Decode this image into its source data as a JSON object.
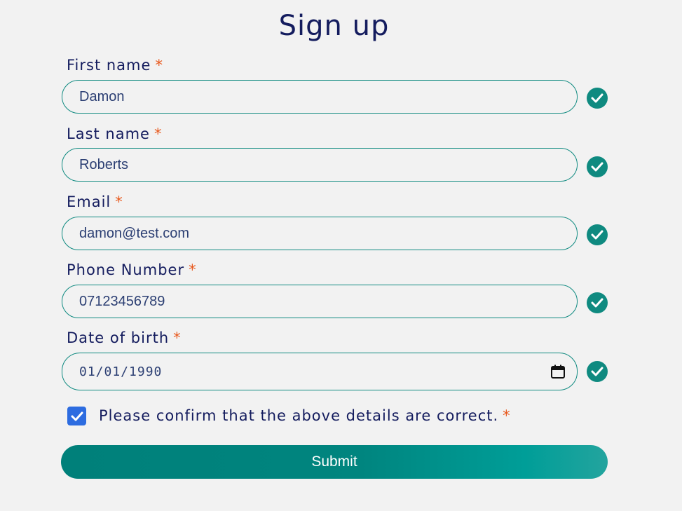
{
  "form": {
    "title": "Sign up",
    "required_marker": "*",
    "fields": [
      {
        "label": "First name",
        "value": "Damon",
        "valid": true
      },
      {
        "label": "Last name",
        "value": "Roberts",
        "valid": true
      },
      {
        "label": "Email",
        "value": "damon@test.com",
        "valid": true
      },
      {
        "label": "Phone Number",
        "value": "07123456789",
        "valid": true
      },
      {
        "label": "Date of birth",
        "value": "01/01/1990",
        "valid": true,
        "icon": "calendar-icon"
      }
    ],
    "confirm": {
      "label": "Please confirm that the above details are correct.",
      "checked": true
    },
    "submit_label": "Submit"
  },
  "colors": {
    "background": "#f2f2f2",
    "heading": "#141c5e",
    "accent": "#0f8a80",
    "required": "#e8581c",
    "checkbox": "#2d6ce0"
  }
}
